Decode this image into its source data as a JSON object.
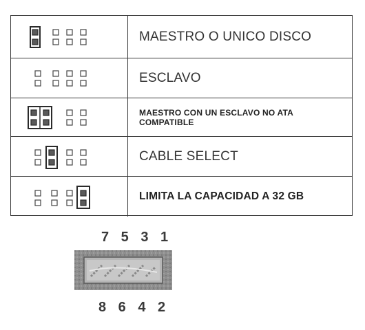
{
  "table": {
    "rows": [
      {
        "label": "MAESTRO O UNICO DISCO",
        "jumper": "pins-1-2"
      },
      {
        "label": "ESCLAVO",
        "jumper": "none"
      },
      {
        "label": "MAESTRO CON UN ESCLAVO NO ATA COMPATIBLE",
        "jumper": "pins-1-2-and-3-4"
      },
      {
        "label": "CABLE SELECT",
        "jumper": "pins-3-4"
      },
      {
        "label": "LIMITA LA CAPACIDAD A 32 GB",
        "jumper": "pins-7-8"
      }
    ]
  },
  "connector": {
    "top_pins": "7 5 3 1",
    "bottom_pins": "8 6 4 2"
  }
}
